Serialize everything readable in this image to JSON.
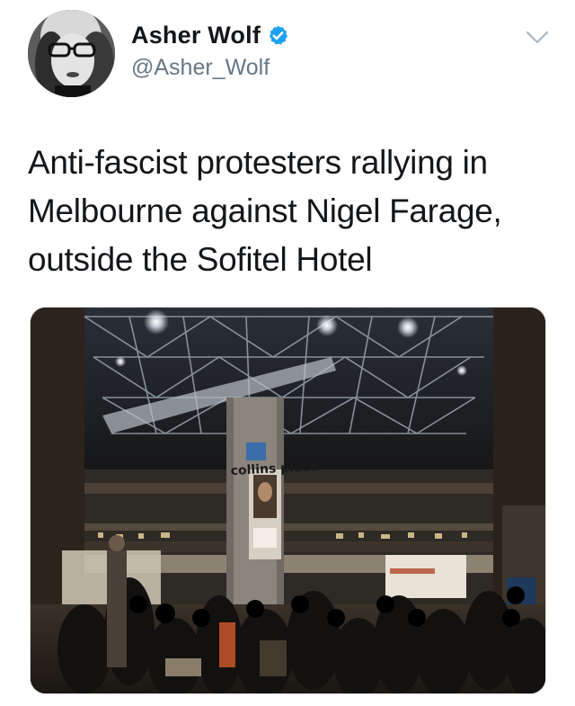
{
  "tweet": {
    "author": {
      "display_name": "Asher Wolf",
      "handle": "@Asher_Wolf",
      "verified": true
    },
    "text": "Anti-fascist protesters rallying in Melbourne against Nigel Farage, outside the Sofitel Hotel",
    "media": {
      "sign_text": "collins place"
    }
  },
  "icons": {
    "verified": "verified-badge-icon",
    "more": "chevron-down-icon"
  },
  "colors": {
    "verified_blue": "#1da1f2",
    "name_text": "#14171a",
    "handle_text": "#657786"
  }
}
